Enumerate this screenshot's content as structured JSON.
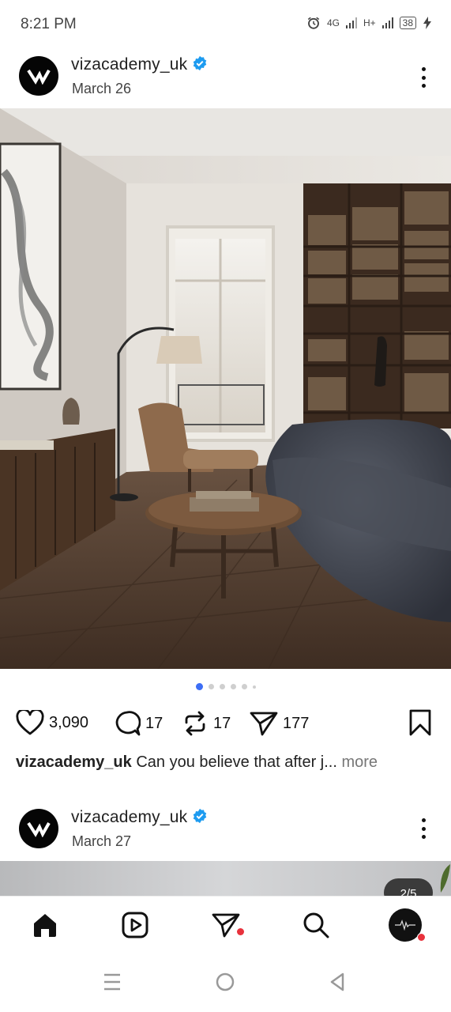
{
  "status_bar": {
    "time": "8:21 PM",
    "network_1": "4G",
    "network_2": "H+",
    "battery": "38"
  },
  "posts": [
    {
      "username": "vizacademy_uk",
      "date": "March 26",
      "verified": true
    },
    {
      "username": "vizacademy_uk",
      "date": "March 27",
      "verified": true,
      "carousel_badge": "2/5"
    }
  ],
  "carousel": {
    "total_dots": 6,
    "active_index": 0
  },
  "actions": {
    "likes": "3,090",
    "comments": "17",
    "reposts": "17",
    "shares": "177"
  },
  "caption": {
    "username": "vizacademy_uk",
    "text": "Can you believe that after j...",
    "more_label": "more"
  },
  "bottom_nav": {
    "items": [
      "home-icon",
      "reels-icon",
      "send-icon",
      "search-icon",
      "profile-avatar"
    ]
  },
  "colors": {
    "accent_blue": "#3d6ef5",
    "verified_blue": "#1d9bf0",
    "notification_red": "#e8323c"
  }
}
